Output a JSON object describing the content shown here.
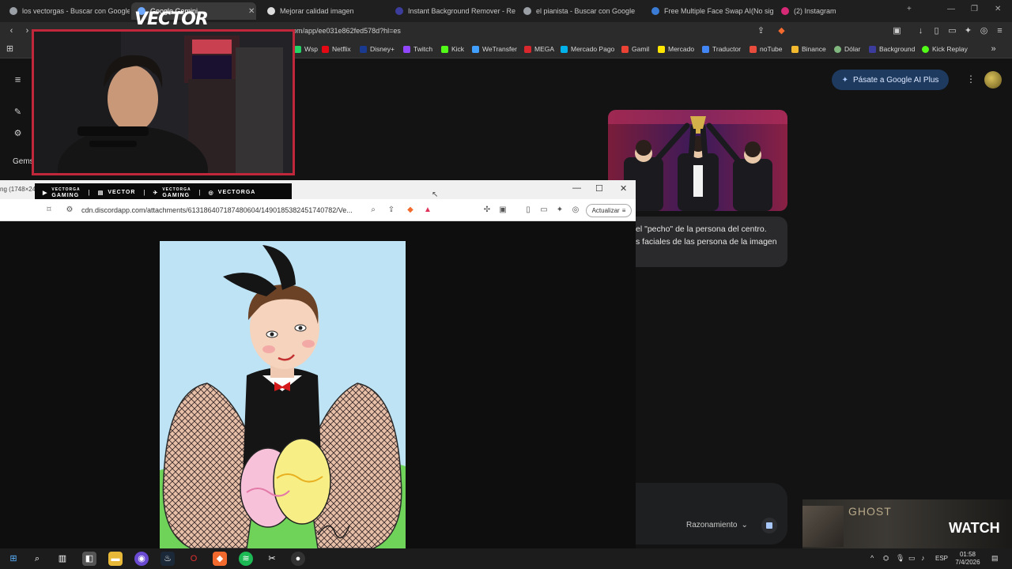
{
  "tabs": [
    {
      "label": "los vectorgas - Buscar con Google",
      "active": false
    },
    {
      "label": "Google Gemini",
      "active": true
    },
    {
      "label": "Mejorar calidad imagen",
      "active": false
    },
    {
      "label": "Instant Background Remover - Remo",
      "active": false
    },
    {
      "label": "el pianista - Buscar con Google",
      "active": false
    },
    {
      "label": "Free Multiple Face Swap AI(No sign-",
      "active": false
    },
    {
      "label": "(2) Instagram",
      "active": false
    }
  ],
  "address": {
    "url": "om/app/ee031e862fed578d?hl=es"
  },
  "bookmarks": [
    {
      "label": "Wsp",
      "color": "#25d366"
    },
    {
      "label": "Netflix",
      "color": "#e50914"
    },
    {
      "label": "Disney+",
      "color": "#1a3a8f"
    },
    {
      "label": "Twitch",
      "color": "#9146ff"
    },
    {
      "label": "Kick",
      "color": "#53fc18"
    },
    {
      "label": "WeTransfer",
      "color": "#409fff"
    },
    {
      "label": "MEGA",
      "color": "#d9272e"
    },
    {
      "label": "Mercado Pago",
      "color": "#00b1ea"
    },
    {
      "label": "Gamil",
      "color": "#ea4335"
    },
    {
      "label": "Mercado",
      "color": "#ffe600"
    },
    {
      "label": "Traductor",
      "color": "#4285f4"
    },
    {
      "label": "noTube",
      "color": "#e74c3c"
    },
    {
      "label": "Binance",
      "color": "#f3ba2f"
    },
    {
      "label": "Dólar",
      "color": "#7fb77e"
    },
    {
      "label": "Background",
      "color": "#3c3c9c"
    },
    {
      "label": "Kick Replay",
      "color": "#53fc18"
    }
  ],
  "gemini": {
    "plus_button": "Pásate a Google AI Plus",
    "side_label": "Gems",
    "bubble_line1": "el \"pecho\" de la persona del centro.",
    "bubble_line2": "s faciales de las persona de la imagen",
    "reasoning_label": "Razonamiento"
  },
  "webcam": {
    "logo": "VECTOR"
  },
  "social": [
    {
      "icon": "youtube-icon",
      "line1": "VECTORGA",
      "line2": "GAMING"
    },
    {
      "icon": "twitch-icon",
      "line1": "VECTOR",
      "line2": ""
    },
    {
      "icon": "twitter-icon",
      "line1": "VECTORGA",
      "line2": "GAMING"
    },
    {
      "icon": "instagram-icon",
      "line1": "VECTORGA",
      "line2": ""
    }
  ],
  "viewer": {
    "title_partial": "ng (1748×24",
    "url": "cdn.discordapp.com/attachments/613186407187480604/1490185382451740782/Ve...",
    "update_button": "Actualizar"
  },
  "ghost": {
    "title": "GHOST",
    "cta": "WATCH"
  },
  "taskbar": {
    "lang": "ESP",
    "time": "01:58",
    "date": "7/4/2026"
  },
  "colors": {
    "accent_red": "#c0273a",
    "gemini_plus": "#1e3a5f",
    "stop_blue": "#a8c7fa"
  }
}
